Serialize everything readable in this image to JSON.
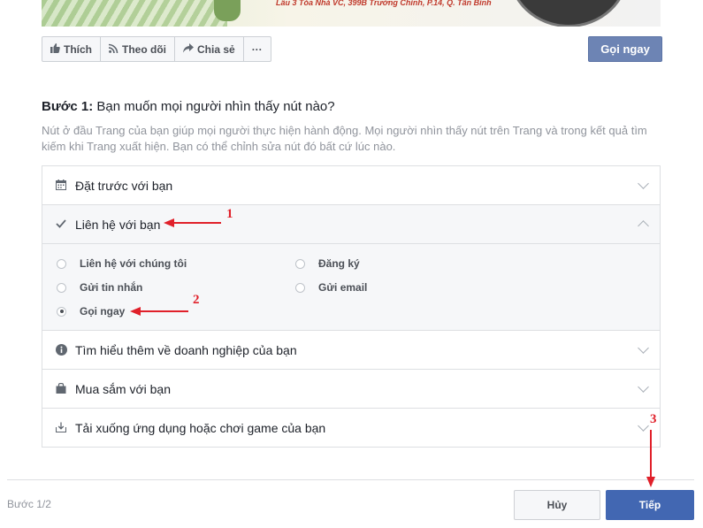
{
  "cover": {
    "address_text": "Lầu 3 Tòa Nhà VC, 399B Trường Chinh, P.14, Q. Tân Bình"
  },
  "actions": [
    {
      "icon": "thumbs-up-icon",
      "label": "Thích"
    },
    {
      "icon": "rss-icon",
      "label": "Theo dõi"
    },
    {
      "icon": "share-arrow-icon",
      "label": "Chia sẻ"
    },
    {
      "icon": "more-icon",
      "label": "···"
    }
  ],
  "call_button_label": "Gọi ngay",
  "step": {
    "title_prefix": "Bước 1:",
    "title_text": " Bạn muốn mọi người nhìn thấy nút nào?",
    "description": "Nút ở đầu Trang của bạn giúp mọi người thực hiện hành động. Mọi người nhìn thấy nút trên Trang và trong kết quả tìm kiếm khi Trang xuất hiện. Bạn có thể chỉnh sửa nút đó bất cứ lúc nào."
  },
  "accordion": [
    {
      "icon": "calendar-icon",
      "label": "Đặt trước với bạn",
      "expanded": false
    },
    {
      "icon": "checkmark-icon",
      "label": "Liên hệ với bạn",
      "expanded": true,
      "options": [
        {
          "label": "Liên hệ với chúng tôi",
          "selected": false
        },
        {
          "label": "Đăng ký",
          "selected": false
        },
        {
          "label": "Gửi tin nhắn",
          "selected": false
        },
        {
          "label": "Gửi email",
          "selected": false
        },
        {
          "label": "Gọi ngay",
          "selected": true
        }
      ]
    },
    {
      "icon": "info-icon",
      "label": "Tìm hiểu thêm về doanh nghiệp của bạn",
      "expanded": false
    },
    {
      "icon": "shopping-bag-icon",
      "label": "Mua sắm với bạn",
      "expanded": false
    },
    {
      "icon": "download-icon",
      "label": "Tải xuống ứng dụng hoặc chơi game của bạn",
      "expanded": false
    }
  ],
  "footer": {
    "step_info": "Bước 1/2",
    "cancel_label": "Hủy",
    "next_label": "Tiếp"
  },
  "annotations": {
    "num1": "1",
    "num2": "2",
    "num3": "3",
    "color": "#e0202a"
  },
  "colors": {
    "primary_button": "#4267b2",
    "call_button": "#6d84b4"
  }
}
